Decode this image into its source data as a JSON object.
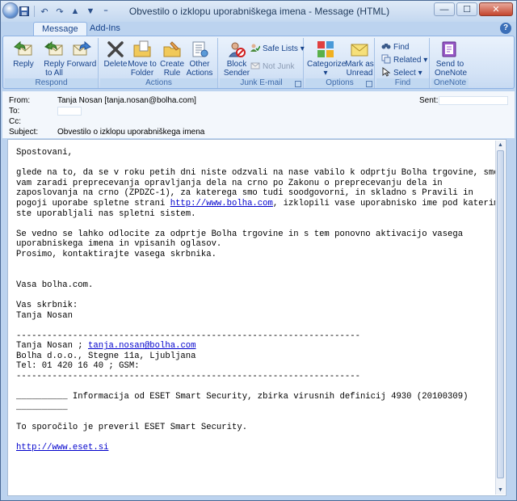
{
  "window": {
    "title": "Obvestilo o izklopu uporabniškega imena - Message (HTML)",
    "accent": "#15428b"
  },
  "tabs": [
    {
      "label": "Message",
      "active": true
    },
    {
      "label": "Add-Ins",
      "active": false
    }
  ],
  "ribbon": {
    "respond": {
      "label": "Respond",
      "reply": "Reply",
      "reply_all": "Reply\nto All",
      "forward": "Forward"
    },
    "actions": {
      "label": "Actions",
      "delete": "Delete",
      "move_to_folder": "Move to\nFolder ▾",
      "create_rule": "Create\nRule",
      "other_actions": "Other\nActions ▾"
    },
    "junk": {
      "label": "Junk E-mail",
      "block_sender": "Block\nSender",
      "safe_lists": "Safe Lists ▾",
      "not_junk": "Not Junk"
    },
    "options": {
      "label": "Options",
      "categorize": "Categorize\n▾",
      "mark_as_unread": "Mark as\nUnread"
    },
    "find": {
      "label": "Find",
      "find": "Find",
      "related": "Related ▾",
      "select": "Select ▾"
    },
    "onenote": {
      "label": "OneNote",
      "send_to_onenote": "Send to\nOneNote"
    }
  },
  "header": {
    "from_label": "From:",
    "from_value": "Tanja Nosan [tanja.nosan@bolha.com]",
    "to_label": "To:",
    "cc_label": "Cc:",
    "subject_label": "Subject:",
    "subject_value": "Obvestilo o izklopu uporabniškega imena",
    "sent_label": "Sent:"
  },
  "message": {
    "greeting": "Spostovani,",
    "para1_before_link": "glede na to, da se v roku petih dni niste odzvali na nase vabilo k odprtju Bolha trgovine, smo\nvam zaradi preprecevanja opravljanja dela na crno po Zakonu o preprecevanju dela in\nzaposlovanja na crno (ZPDZC-1), za katerega smo tudi soodgovorni, in skladno s Pravili in\npogoji uporabe spletne strani ",
    "para1_link": "http://www.bolha.com",
    "para1_after_link": ", izklopili vase uporabnisko ime pod katerim\nste uporabljali nas spletni sistem.",
    "para2": "Se vedno se lahko odlocite za odprtje Bolha trgovine in s tem ponovno aktivacijo vasega\nuporabniskega imena in vpisanih oglasov.\nProsimo, kontaktirajte vasega skrbnika.",
    "signoff": "Vasa bolha.com.",
    "admin_label": "Vas skrbnik:",
    "admin_name": "Tanja Nosan",
    "divider": "-------------------------------------------------------------------",
    "sig_name": "Tanja Nosan ; ",
    "sig_email": "tanja.nosan@bolha.com",
    "sig_address": "Bolha d.o.o., Stegne 11a, Ljubljana",
    "sig_phone": "Tel: 01 420 16 40 ; GSM:",
    "eset_underline": "__________",
    "eset_info": " Informacija od ESET Smart Security, zbirka virusnih definicij 4930 (20100309)",
    "eset_checked": "To sporočilo je preveril ESET Smart Security.",
    "eset_link": "http://www.eset.si"
  }
}
